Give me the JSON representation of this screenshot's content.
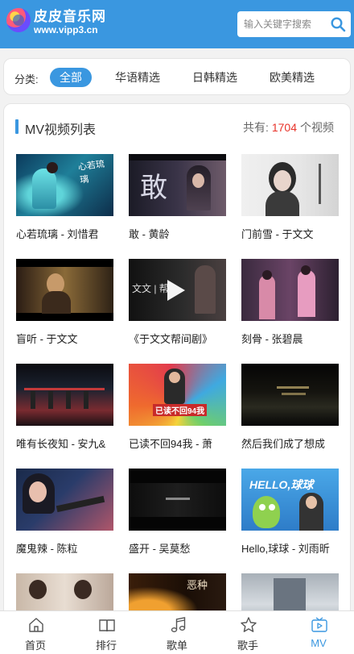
{
  "header": {
    "brand_name": "皮皮音乐网",
    "brand_url": "www.vipp3.cn"
  },
  "search": {
    "placeholder": "输入关键字搜索"
  },
  "categories": {
    "label": "分类:",
    "items": [
      {
        "label": "全部",
        "active": true
      },
      {
        "label": "华语精选",
        "active": false
      },
      {
        "label": "日韩精选",
        "active": false
      },
      {
        "label": "欧美精选",
        "active": false
      }
    ]
  },
  "mv_list": {
    "title": "MV视频列表",
    "total_prefix": "共有:",
    "total_count": "1704",
    "total_suffix": "个视频",
    "videos": [
      {
        "title": "心若琉璃 - 刘惜君"
      },
      {
        "title": "敢 - 黄龄"
      },
      {
        "title": "门前雪 - 于文文"
      },
      {
        "title": "盲听 - 于文文"
      },
      {
        "title": "《于文文帮间剧》"
      },
      {
        "title": "刻骨 - 张碧晨"
      },
      {
        "title": "唯有长夜知 - 安九&"
      },
      {
        "title": "已读不回94我 - 萧"
      },
      {
        "title": "然后我们成了想成"
      },
      {
        "title": "魔鬼辣 - 陈粒"
      },
      {
        "title": "盛开 - 吴莫愁"
      },
      {
        "title": "Hello,球球 - 刘雨昕"
      },
      {
        "title": ""
      },
      {
        "title": ""
      },
      {
        "title": ""
      }
    ],
    "thumb_text": {
      "v0": "心若琉璃",
      "v1": "敢",
      "v4": "文文 | 帮",
      "v7": "已读不回94我",
      "v11": "HELLO,球球",
      "v13": "恶种"
    }
  },
  "tabbar": {
    "items": [
      {
        "label": "首页",
        "icon": "home-icon",
        "active": false
      },
      {
        "label": "排行",
        "icon": "book-icon",
        "active": false
      },
      {
        "label": "歌单",
        "icon": "music-note-icon",
        "active": false
      },
      {
        "label": "歌手",
        "icon": "star-icon",
        "active": false
      },
      {
        "label": "MV",
        "icon": "tv-icon",
        "active": true
      }
    ]
  },
  "colors": {
    "accent": "#3a97e0",
    "count_red": "#e8332a",
    "background": "#f2f2f2"
  }
}
